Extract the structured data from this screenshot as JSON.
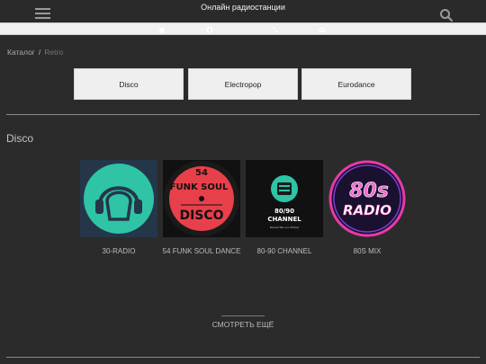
{
  "header": {
    "title": "Онлайн радиостанции",
    "menu_icon": "hamburger-icon",
    "search_icon": "search-icon"
  },
  "icon_bar": [
    "home-icon",
    "info-icon",
    "phone-icon",
    "mail-icon"
  ],
  "breadcrumb": {
    "items": [
      "Каталог",
      "Retro"
    ],
    "separator": "/"
  },
  "genres": [
    "Disco",
    "Electropop",
    "Eurodance"
  ],
  "section": {
    "title": "Disco",
    "stations": [
      {
        "name": "30-RADIO",
        "cover": "headphones-logo"
      },
      {
        "name": "54 FUNK SOUL DANCE",
        "cover": "vinyl-record-logo",
        "cover_text_top": "54",
        "cover_text_mid": "FUNK SOUL",
        "cover_text_bottom": "DISCO"
      },
      {
        "name": "80-90 CHANNEL",
        "cover": "radio-channel-logo",
        "cover_text_1": "80/90",
        "cover_text_2": "CHANNEL",
        "cover_text_3": "Deine Hits von Früher"
      },
      {
        "name": "80S MIX",
        "cover": "80s-radio-logo",
        "cover_text_1": "80s",
        "cover_text_2": "RADIO"
      }
    ],
    "more_label": "СМОТРЕТЬ ЕЩЁ"
  },
  "colors": {
    "background": "#2b2b2b",
    "button_bg": "#efefef",
    "teal": "#2ec4a5",
    "red": "#e8404a",
    "pink": "#e83aa8"
  }
}
